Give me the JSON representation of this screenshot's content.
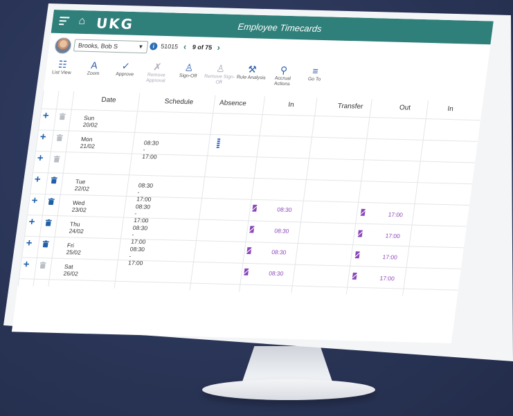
{
  "app": {
    "logo": "UKG",
    "title": "Employee Timecards"
  },
  "employee": {
    "name": "Brooks, Bob S",
    "id": "51015",
    "pager": "9 of 75"
  },
  "toolbar": [
    {
      "icon": "list-view-icon",
      "glyph": "☷",
      "label": "List View",
      "enabled": true
    },
    {
      "icon": "zoom-icon",
      "glyph": "A",
      "label": "Zoom",
      "enabled": true
    },
    {
      "icon": "approve-icon",
      "glyph": "✓",
      "label": "Approve",
      "enabled": true
    },
    {
      "icon": "remove-approval-icon",
      "glyph": "✗",
      "label": "Remove Approval",
      "enabled": false
    },
    {
      "icon": "sign-off-icon",
      "glyph": "♙",
      "label": "Sign-Off",
      "enabled": true
    },
    {
      "icon": "remove-sign-off-icon",
      "glyph": "♙",
      "label": "Remove Sign-Off",
      "enabled": false
    },
    {
      "icon": "rule-analysis-icon",
      "glyph": "⚒",
      "label": "Rule Analysis",
      "enabled": true
    },
    {
      "icon": "accrual-actions-icon",
      "glyph": "⚲",
      "label": "Accrual Actions",
      "enabled": true
    },
    {
      "icon": "go-to-icon",
      "glyph": "≡",
      "label": "Go To",
      "enabled": true
    }
  ],
  "columns": [
    "Date",
    "Schedule",
    "Absence",
    "In",
    "Transfer",
    "Out",
    "In"
  ],
  "rows": [
    {
      "date": "Sun 20/02",
      "schedule": "",
      "in": "",
      "out": "",
      "trash_active": false,
      "absence_mark": false
    },
    {
      "date": "Mon 21/02",
      "schedule": "08:30 - 17:00",
      "in": "",
      "out": "",
      "trash_active": false,
      "absence_mark": true
    },
    {
      "date": "",
      "schedule": "",
      "in": "",
      "out": "",
      "trash_active": false,
      "absence_mark": false
    },
    {
      "date": "Tue 22/02",
      "schedule": "08:30 - 17:00",
      "in": "",
      "out": "",
      "trash_active": true,
      "absence_mark": false
    },
    {
      "date": "Wed 23/02",
      "schedule": "08:30 - 17:00",
      "in": "08:30",
      "out": "17:00",
      "trash_active": true,
      "absence_mark": false
    },
    {
      "date": "Thu 24/02",
      "schedule": "08:30 - 17:00",
      "in": "08:30",
      "out": "17:00",
      "trash_active": true,
      "absence_mark": false
    },
    {
      "date": "Fri 25/02",
      "schedule": "08:30 - 17:00",
      "in": "08:30",
      "out": "17:00",
      "trash_active": true,
      "absence_mark": false
    },
    {
      "date": "Sat 26/02",
      "schedule": "",
      "in": "08:30",
      "out": "17:00",
      "trash_active": false,
      "absence_mark": false
    }
  ],
  "colors": {
    "header_bar": "#2f7f7a",
    "accent_blue": "#1f5fa8",
    "punch_purple": "#8a46b8",
    "background": "#2a3557"
  }
}
